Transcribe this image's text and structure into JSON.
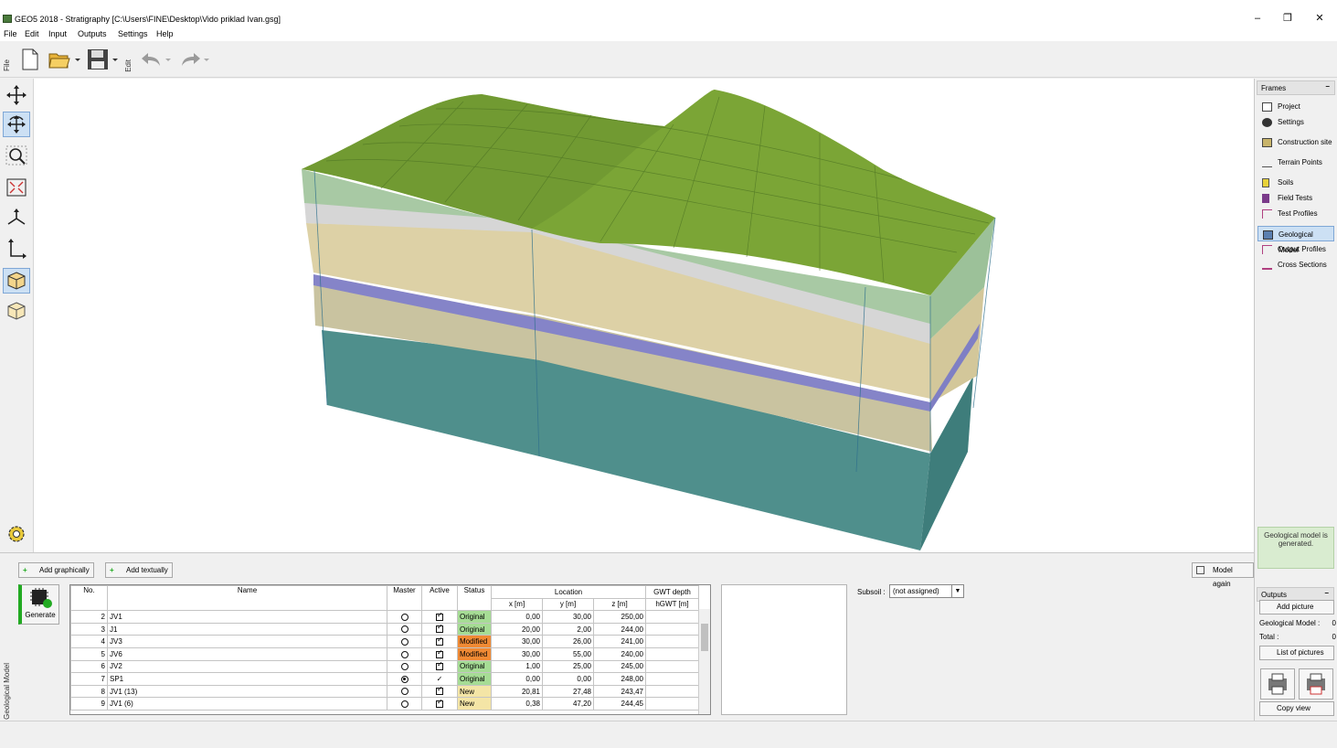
{
  "window": {
    "title": "GEO5 2018 - Stratigraphy [C:\\Users\\FINE\\Desktop\\Vido priklad Ivan.gsg]",
    "minimize": "–",
    "restore": "❐",
    "close": "✕"
  },
  "menu": [
    "File",
    "Edit",
    "Input",
    "Outputs",
    "Settings",
    "Help"
  ],
  "toolbar": {
    "file_label": "File",
    "edit_label": "Edit"
  },
  "frames": {
    "header": "Frames",
    "minimize": "–",
    "items": [
      {
        "label": "Project",
        "icon": "project-icon"
      },
      {
        "label": "Settings",
        "icon": "settings-icon"
      },
      {
        "label": "Construction site",
        "icon": "construction-site-icon"
      },
      {
        "label": "Terrain Points",
        "icon": "terrain-points-icon"
      },
      {
        "label": "Soils",
        "icon": "soils-icon"
      },
      {
        "label": "Field Tests",
        "icon": "field-tests-icon"
      },
      {
        "label": "Test Profiles",
        "icon": "test-profiles-icon"
      },
      {
        "label": "Geological Model",
        "icon": "geological-model-icon",
        "active": true
      },
      {
        "label": "Output Profiles",
        "icon": "output-profiles-icon"
      },
      {
        "label": "Cross Sections",
        "icon": "cross-sections-icon"
      }
    ],
    "status_note": "Geological model is generated."
  },
  "outputs": {
    "header": "Outputs",
    "minimize": "–",
    "add_picture": "Add picture",
    "geological_model_label": "Geological Model :",
    "geological_model_count": "0",
    "total_label": "Total :",
    "total_count": "0",
    "list_of_pictures": "List of pictures",
    "copy_view": "Copy view"
  },
  "bottom": {
    "side_label": "Geological Model",
    "add_graphically": "Add graphically",
    "add_textually": "Add textually",
    "model_again": "Model again",
    "generate": "Generate",
    "subsoil_label": "Subsoil :",
    "subsoil_value": "(not assigned)"
  },
  "table": {
    "headers": {
      "no": "No.",
      "name": "Name",
      "master": "Master",
      "active": "Active",
      "status": "Status",
      "location": "Location",
      "x": "x [m]",
      "y": "y [m]",
      "z": "z [m]",
      "gwt": "GWT depth",
      "hgwt": "hGWT [m]"
    },
    "rows": [
      {
        "no": "2",
        "name": "JV1",
        "master": false,
        "active": "check",
        "status": "Original",
        "x": "0,00",
        "y": "30,00",
        "z": "250,00"
      },
      {
        "no": "3",
        "name": "J1",
        "master": false,
        "active": "check",
        "status": "Original",
        "x": "20,00",
        "y": "2,00",
        "z": "244,00"
      },
      {
        "no": "4",
        "name": "JV3",
        "master": false,
        "active": "check",
        "status": "Modified",
        "x": "30,00",
        "y": "26,00",
        "z": "241,00"
      },
      {
        "no": "5",
        "name": "JV6",
        "master": false,
        "active": "check",
        "status": "Modified",
        "x": "30,00",
        "y": "55,00",
        "z": "240,00"
      },
      {
        "no": "6",
        "name": "JV2",
        "master": false,
        "active": "check",
        "status": "Original",
        "x": "1,00",
        "y": "25,00",
        "z": "245,00"
      },
      {
        "no": "7",
        "name": "SP1",
        "master": true,
        "active": "tick",
        "status": "Original",
        "x": "0,00",
        "y": "0,00",
        "z": "248,00"
      },
      {
        "no": "8",
        "name": "JV1 (13)",
        "master": false,
        "active": "check",
        "status": "New",
        "x": "20,81",
        "y": "27,48",
        "z": "243,47"
      },
      {
        "no": "9",
        "name": "JV1 (6)",
        "master": false,
        "active": "check",
        "status": "New",
        "x": "0,38",
        "y": "47,20",
        "z": "244,45"
      }
    ]
  }
}
